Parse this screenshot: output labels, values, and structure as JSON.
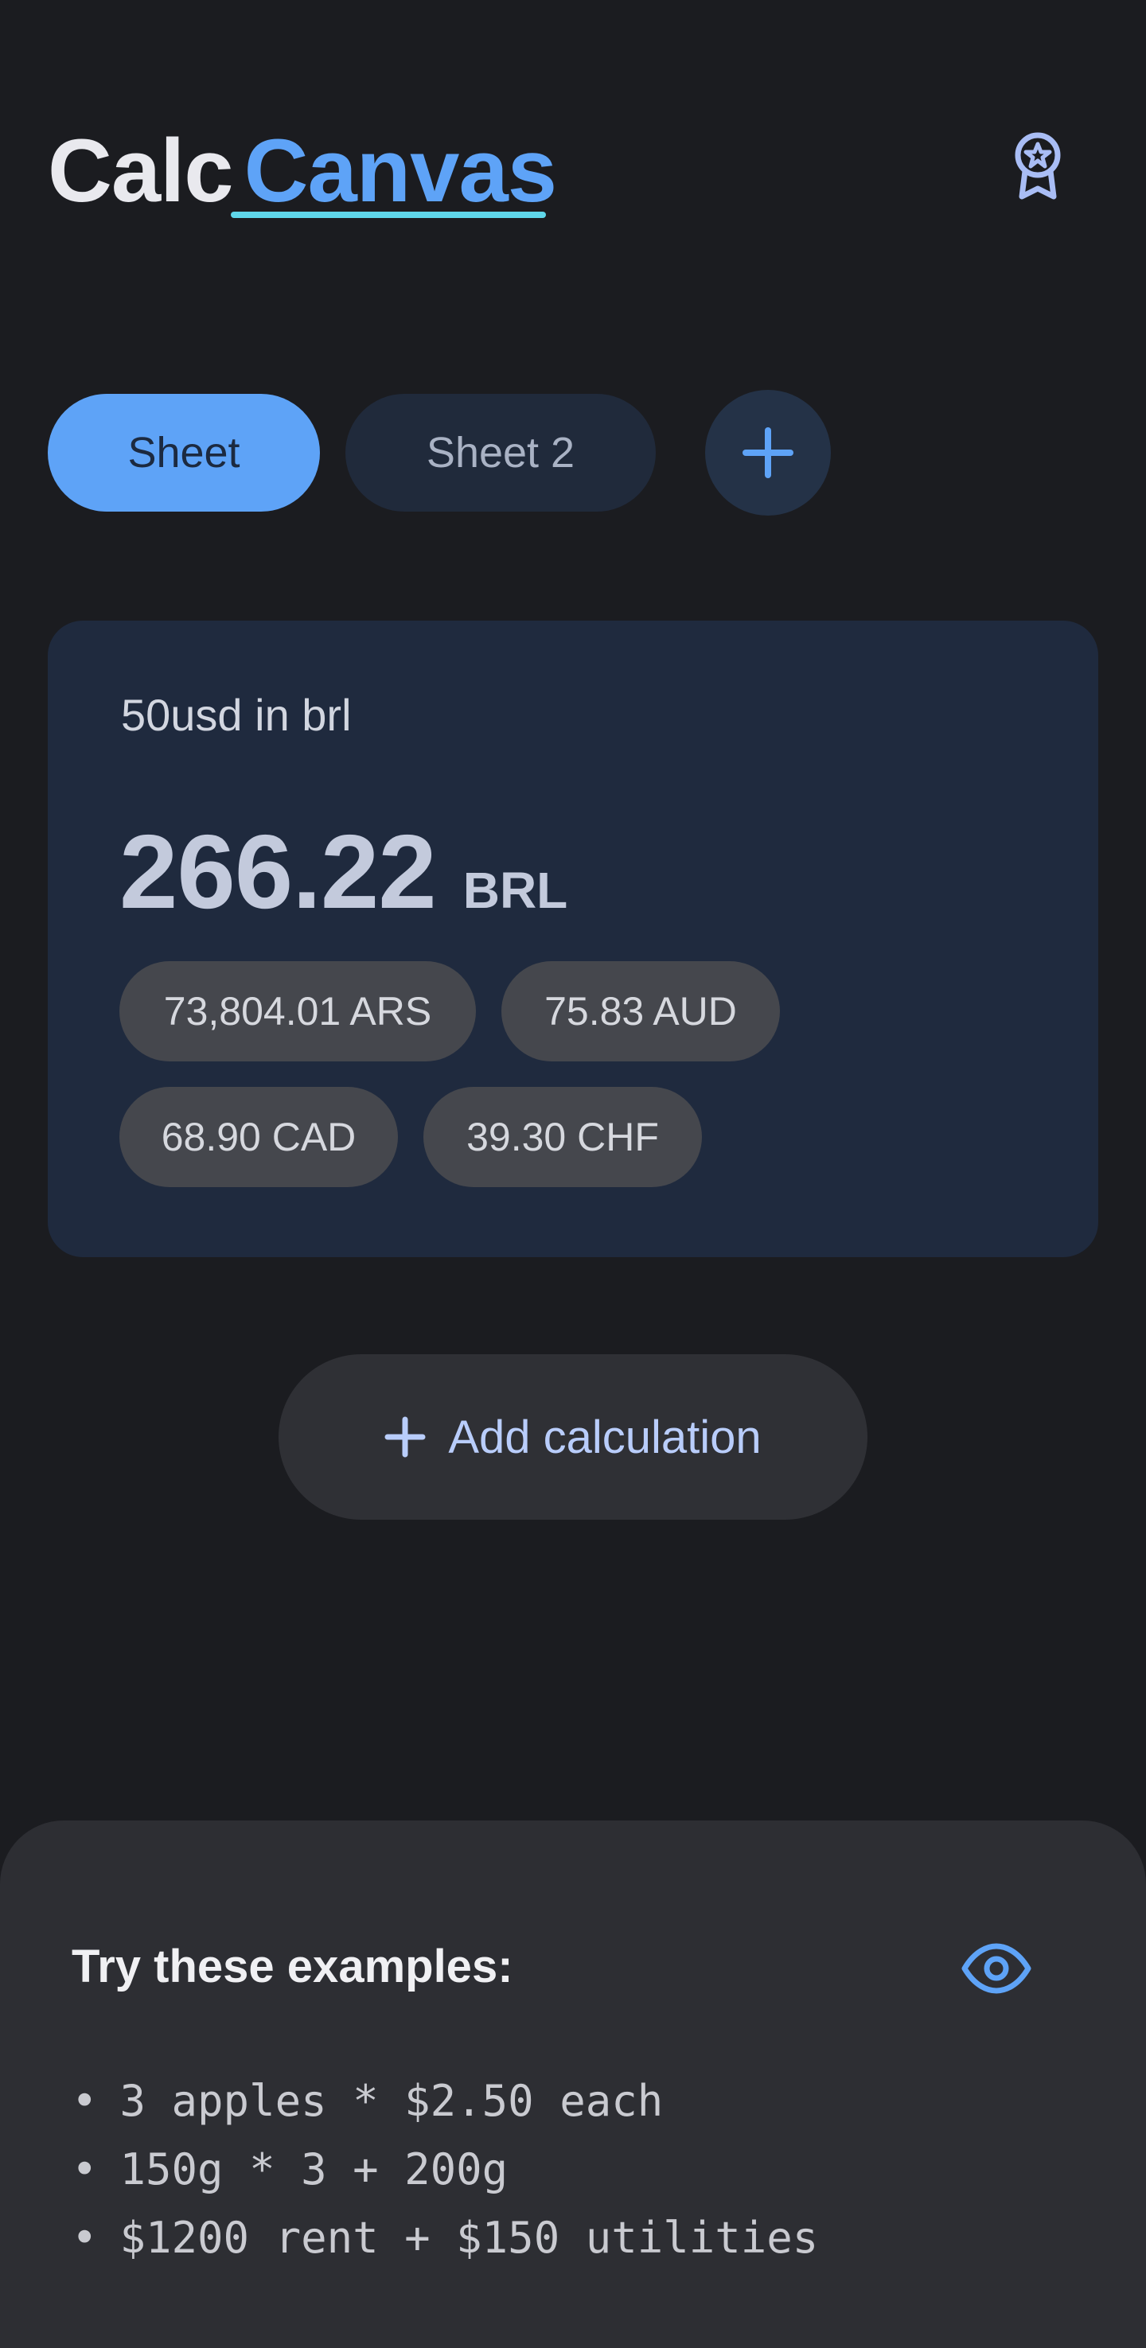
{
  "header": {
    "brand_part1": "Calc",
    "brand_part2": "Canvas",
    "award_icon": "award-ribbon-icon"
  },
  "tabs": [
    {
      "label": "Sheet",
      "active": true
    },
    {
      "label": "Sheet 2",
      "active": false
    }
  ],
  "add_tab_icon": "plus-icon",
  "calculation": {
    "expression": "50usd in brl",
    "result_value": "266.22",
    "result_unit": "BRL",
    "conversions": [
      "73,804.01 ARS",
      "75.83 AUD",
      "68.90 CAD",
      "39.30 CHF"
    ]
  },
  "add_calculation": {
    "label": "Add calculation",
    "icon": "plus-icon"
  },
  "examples": {
    "title": "Try these examples:",
    "toggle_icon": "eye-icon",
    "bullet": "•",
    "items": [
      "3 apples * $2.50 each",
      "150g * 3 + 200g",
      "$1200 rent + $150 utilities"
    ]
  },
  "colors": {
    "background": "#1b1c20",
    "accent": "#5ea3f7",
    "underline": "#5fd7ea",
    "card": "#1f2a3e",
    "chip": "#45474d",
    "sheet": "#2d2e33"
  }
}
